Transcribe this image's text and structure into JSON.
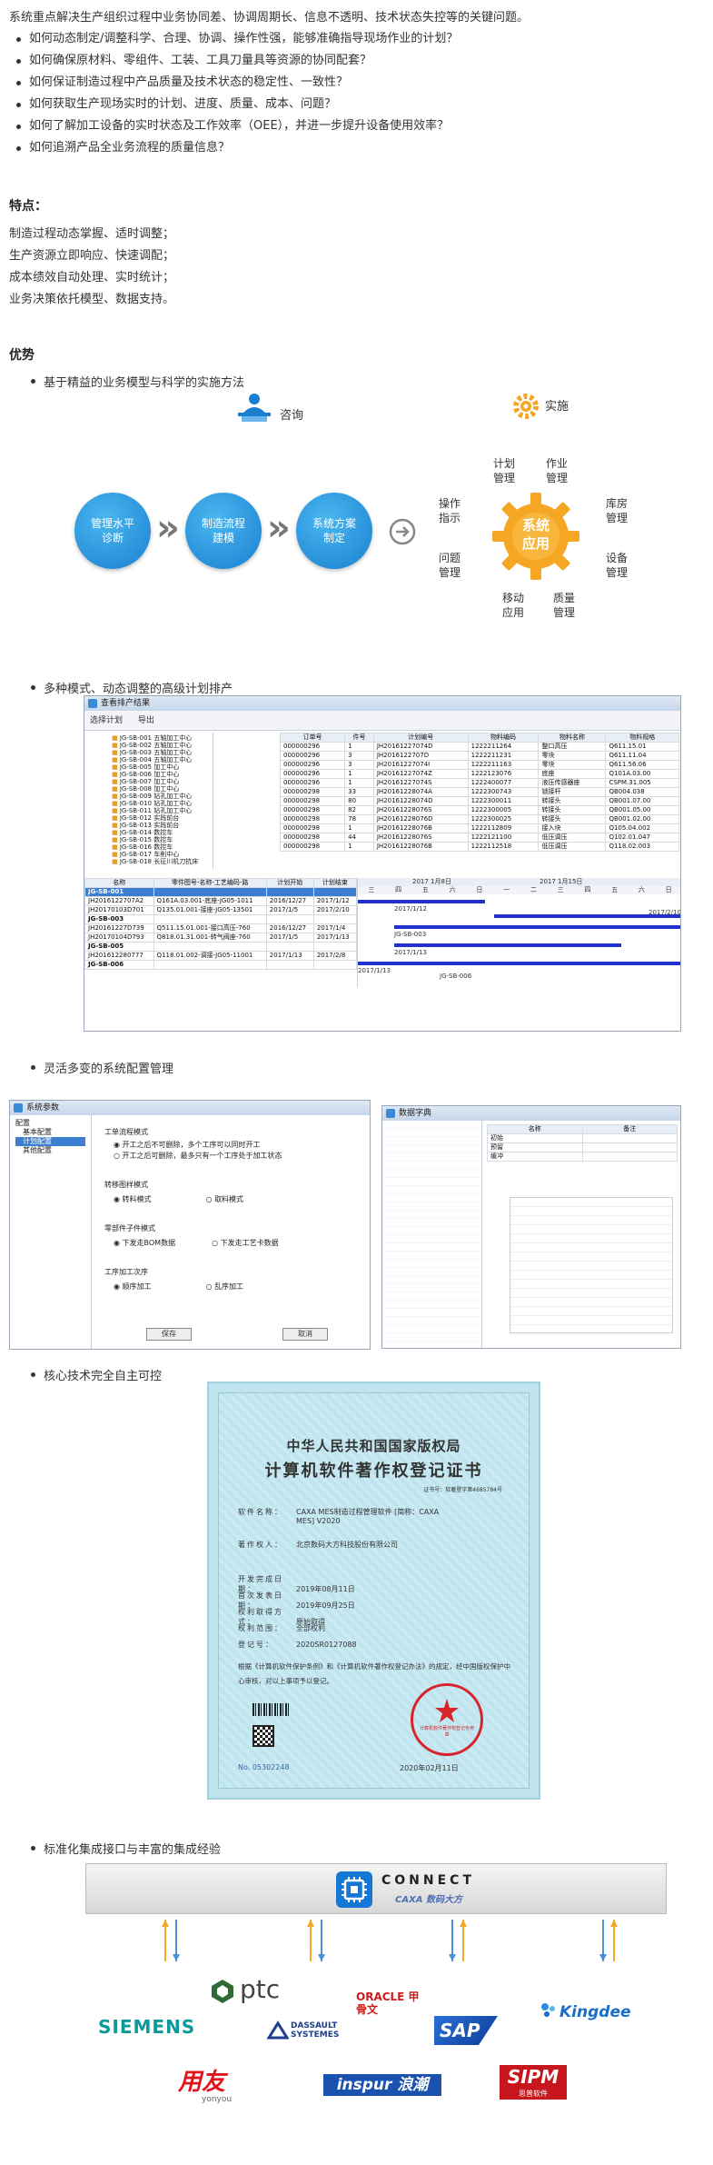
{
  "intro": {
    "lead": "系统重点解决生产组织过程中业务协同差、协调周期长、信息不透明、技术状态失控等的关键问题。",
    "questions": [
      "如何动态制定/调整科学、合理、协调、操作性强，能够准确指导现场作业的计划？",
      "如何确保原材料、零组件、工装、工具刀量具等资源的协同配套？",
      "如何保证制造过程中产品质量及技术状态的稳定性、一致性？",
      "如何获取生产现场实时的计划、进度、质量、成本、问题？",
      "如何了解加工设备的实时状态及工作效率（OEE），并进一步提升设备使用效率？",
      "如何追溯产品全业务流程的质量信息？"
    ]
  },
  "features": {
    "title": "特点：",
    "lines": [
      "制造过程动态掌握、适时调整；",
      "生产资源立即响应、快速调配；",
      "成本绩效自动处理、实时统计；",
      "业务决策依托模型、数据支持。"
    ]
  },
  "advantages": {
    "title": "优势",
    "items": [
      "基于精益的业务模型与科学的实施方法",
      "多种模式、动态调整的高级计划排产",
      "灵活多变的系统配置管理",
      "核心技术完全自主可控",
      "标准化集成接口与丰富的集成经验"
    ]
  },
  "diagram": {
    "consult_label": "咨询",
    "implement_label": "实施",
    "steps": [
      "管理水平诊断",
      "制造流程建模",
      "系统方案制定"
    ],
    "center": "系统应用",
    "modules": [
      "计划管理",
      "作业管理",
      "库房管理",
      "设备管理",
      "质量管理",
      "移动应用",
      "问题管理",
      "操作指示"
    ]
  },
  "aps_window": {
    "title": "查看排产结果",
    "toolbar": [
      "选择计划",
      "导出"
    ],
    "tree_items": [
      "JG-SB-001 五轴加工中心",
      "JG-SB-002 五轴加工中心",
      "JG-SB-003 五轴加工中心",
      "JG-SB-004 五轴加工中心",
      "JG-SB-005 加工中心",
      "JG-SB-006 加工中心",
      "JG-SB-007 加工中心",
      "JG-SB-008 加工中心",
      "JG-SB-009 钻孔加工中心",
      "JG-SB-010 钻孔加工中心",
      "JG-SB-011 钻孔加工中心",
      "JG-SB-012 实践前台",
      "JG-SB-013 实践前台",
      "JG-SB-014 数控车",
      "JG-SB-015 数控车",
      "JG-SB-016 数控车",
      "JG-SB-017 车削中心",
      "JG-SB-018 长征川机刀抗床"
    ],
    "table_headers": [
      "订单号",
      "件号",
      "计划编号",
      "物料编码",
      "物料名称",
      "物料规格"
    ],
    "table_rows": [
      [
        "000000296",
        "1",
        "JH20161227074D",
        "1222211264",
        "整口高压",
        "Q611.15.01"
      ],
      [
        "000000296",
        "3",
        "JH2016122707D",
        "1222211231",
        "零块",
        "Q611.11.04"
      ],
      [
        "000000296",
        "3",
        "JH20161227074I",
        "1222211163",
        "零块",
        "Q611.56.06"
      ],
      [
        "000000296",
        "1",
        "JH20161227074Z",
        "1222123076",
        "底座",
        "Q101A.03.00"
      ],
      [
        "000000296",
        "1",
        "JH20161227074S",
        "1222400077",
        "液压传感器座",
        "CSPM.31.005"
      ],
      [
        "000000298",
        "33",
        "JH20161228074A",
        "1222300743",
        "锁接杆",
        "QB004.038"
      ],
      [
        "000000298",
        "80",
        "JH20161228074D",
        "1222300011",
        "转接头",
        "QB001.07.00"
      ],
      [
        "000000298",
        "82",
        "JH20161228076S",
        "1222300005",
        "转接头",
        "QB001.05.00"
      ],
      [
        "000000298",
        "78",
        "JH20161228076D",
        "1222300025",
        "转接头",
        "QB001.02.00"
      ],
      [
        "000000298",
        "1",
        "JH20161228076B",
        "1222112809",
        "接入块",
        "Q105.04.002"
      ],
      [
        "000000298",
        "44",
        "JH20161228076S",
        "1222121100",
        "低压调压",
        "Q102.01.047"
      ],
      [
        "000000298",
        "1",
        "JH20161228076B",
        "1222112518",
        "低压调压",
        "Q118.02.003"
      ]
    ],
    "gantt_headers": [
      "名称",
      "零件图号-名称-工艺编码-路",
      "计划开始",
      "计划结束"
    ],
    "gantt_rows": [
      [
        "JG-SB-001",
        "",
        "",
        ""
      ],
      [
        "JH2016122707A2",
        "Q161A.03.001-底座-JG05-1011",
        "2016/12/27",
        "2017/1/12"
      ],
      [
        "JH20170103D701",
        "Q135.01.001-接座-JG05-13501",
        "2017/1/5",
        "2017/2/10"
      ],
      [
        "JG-SB-003",
        "",
        "",
        ""
      ],
      [
        "JH20161227D739",
        "Q511.15.01.001-接口高压-760",
        "2016/12/27",
        "2017/1/4"
      ],
      [
        "JH20170104D793",
        "Q818.01.31.001-转气阀座-760",
        "2017/1/5",
        "2017/1/13"
      ],
      [
        "JG-SB-005",
        "",
        "",
        ""
      ],
      [
        "JH201612280777",
        "Q118.01.002-调接-JG05-11001",
        "2017/1/13",
        "2017/2/8"
      ],
      [
        "JG-SB-006",
        "",
        "",
        ""
      ]
    ],
    "gantt_months": [
      "2017 1月8日",
      "2017 1月15日"
    ],
    "gantt_days": [
      "三",
      "四",
      "五",
      "六",
      "日",
      "一",
      "二",
      "三",
      "四",
      "五",
      "六",
      "日"
    ],
    "gantt_bar_labels": [
      "2017/1/12",
      "2017/2/10",
      "JG-SB-003",
      "2017/1/13",
      "2017/1/13",
      "JG-SB-006"
    ]
  },
  "config_window": {
    "title": "系统参数",
    "tree": [
      "配置",
      "基本配置",
      "计划配置",
      "其他配置"
    ],
    "groups": [
      {
        "title": "工单流程模式",
        "options": [
          "开工之后不可删除，多个工序可以同时开工",
          "开工之后可删除，最多只有一个工序处于加工状态"
        ]
      },
      {
        "title": "转移图样模式",
        "options": [
          "转料模式",
          "取料模式"
        ]
      },
      {
        "title": "零部件子件模式",
        "options": [
          "下发走BOM数据",
          "下发走工艺卡数据"
        ]
      },
      {
        "title": "工序加工次序",
        "options": [
          "顺序加工",
          "乱序加工"
        ]
      }
    ],
    "save_label": "保存",
    "cancel_label": "取消"
  },
  "config_window2": {
    "title": "数据字典",
    "columns": [
      "名称",
      "备注"
    ],
    "rows": [
      [
        "初始",
        ""
      ],
      [
        "预留",
        ""
      ],
      [
        "缓冲",
        ""
      ]
    ]
  },
  "certificate": {
    "header1": "中华人民共和国国家版权局",
    "header2": "计算机软件著作权登记证书",
    "cert_no": "证书号：软著登字第4685784号",
    "fields": [
      {
        "k": "软件名称：",
        "v": "CAXA MES制造过程管理软件 [简称：CAXA MES] V2020"
      },
      {
        "k": "著作权人：",
        "v": "北京数码大方科技股份有限公司"
      },
      {
        "k": "开发完成日期：",
        "v": "2019年08月11日"
      },
      {
        "k": "首次发表日期：",
        "v": "2019年09月25日"
      },
      {
        "k": "权利取得方式：",
        "v": "原始取得"
      },
      {
        "k": "权利范围：",
        "v": "全部权利"
      },
      {
        "k": "登记号：",
        "v": "2020SR0127088"
      }
    ],
    "body": "根据《计算机软件保护条例》和《计算机软件著作权登记办法》的规定，经中国版权保护中心审核，对以上事项予以登记。",
    "serial": "No. 05302248",
    "date": "2020年02月11日",
    "seal_text": "计算机软件著作权登记专用章"
  },
  "integration": {
    "connect_title": "CONNECT",
    "connect_sub": "CAXA 数码大方",
    "partners": [
      "SIEMENS",
      "ptc",
      "DASSAULT SYSTEMES",
      "ORACLE 甲骨文",
      "SAP",
      "Kingdee",
      "用友",
      "yonyou",
      "inspur 浪潮",
      "SIPM",
      "思普软件"
    ]
  },
  "colors": {
    "accent_blue": "#1a7fd0",
    "gear_orange": "#f5a623",
    "seal_red": "#d9232a"
  }
}
